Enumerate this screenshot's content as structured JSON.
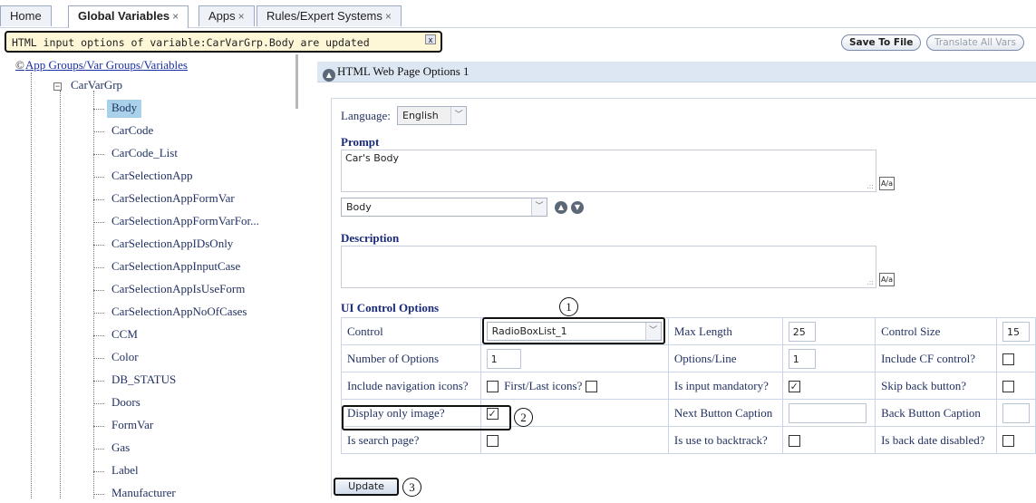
{
  "tabs": [
    {
      "label": "Home",
      "closable": false
    },
    {
      "label": "Global Variables",
      "closable": true,
      "active": true
    },
    {
      "label": "Apps",
      "closable": true
    },
    {
      "label": "Rules/Expert Systems",
      "closable": true
    }
  ],
  "tab_close_glyph": "×",
  "notification": {
    "text": "HTML input options of variable:CarVarGrp.Body are updated",
    "close": "x"
  },
  "toolbar": {
    "save_to_file": "Save To File",
    "translate_all": "Translate All Vars"
  },
  "tree": {
    "root_label": "App Groups/Var Groups/Variables",
    "root_icon": "©",
    "group_label": "CarVarGrp",
    "group_expand_glyph": "−",
    "items": [
      "Body",
      "CarCode",
      "CarCode_List",
      "CarSelectionApp",
      "CarSelectionAppFormVar",
      "CarSelectionAppFormVarFor...",
      "CarSelectionAppIDsOnly",
      "CarSelectionAppInputCase",
      "CarSelectionAppIsUseForm",
      "CarSelectionAppNoOfCases",
      "CCM",
      "Color",
      "DB_STATUS",
      "Doors",
      "FormVar",
      "Gas",
      "Label",
      "Manufacturer"
    ],
    "selected_index": 0
  },
  "panel": {
    "title": "HTML Web Page Options 1",
    "collapse_icon": "up-circle-icon",
    "language_label": "Language:",
    "language_value": "English",
    "prompt_label": "Prompt",
    "prompt_text": "Car's Body",
    "prompt_variant_select": "Body",
    "description_label": "Description",
    "description_text": "",
    "ui_options_label": "UI Control Options",
    "update_button": "Update"
  },
  "options": {
    "rows": [
      [
        {
          "label": "Control",
          "type": "select",
          "value": "RadioBoxList_1"
        },
        {
          "label": "Max Length",
          "type": "input",
          "value": "25"
        },
        {
          "label": "Control Size",
          "type": "input",
          "value": "15"
        }
      ],
      [
        {
          "label": "Number of Options",
          "type": "input",
          "value": "1"
        },
        {
          "label": "Options/Line",
          "type": "input",
          "value": "1"
        },
        {
          "label": "Include CF control?",
          "type": "checkbox",
          "checked": false
        }
      ],
      [
        {
          "label": "Include navigation icons?",
          "type": "checkbox",
          "checked": false,
          "extra_label": "First/Last icons?",
          "extra_checked": false
        },
        {
          "label": "Is input mandatory?",
          "type": "checkbox",
          "checked": true
        },
        {
          "label": "Skip back button?",
          "type": "checkbox",
          "checked": false
        }
      ],
      [
        {
          "label": "Display only image?",
          "type": "checkbox",
          "checked": true
        },
        {
          "label": "Next Button Caption",
          "type": "input",
          "value": ""
        },
        {
          "label": "Back Button Caption",
          "type": "input",
          "value": ""
        }
      ],
      [
        {
          "label": "Is search page?",
          "type": "checkbox",
          "checked": false
        },
        {
          "label": "Is use to backtrack?",
          "type": "checkbox",
          "checked": false
        },
        {
          "label": "Is back date disabled?",
          "type": "checkbox",
          "checked": false
        }
      ]
    ]
  },
  "callouts": [
    "1",
    "2",
    "3"
  ],
  "glyphs": {
    "check": "✓",
    "dropdown": "﹀",
    "up": "▲",
    "down": "▼",
    "grip": ".::",
    "translate": "A/a"
  },
  "colors": {
    "selected_bg": "#a9d1ea",
    "notify_bg": "#fdf7d8",
    "panel_head_bg": "#dde7f3",
    "label_text": "#1f2f5f"
  }
}
